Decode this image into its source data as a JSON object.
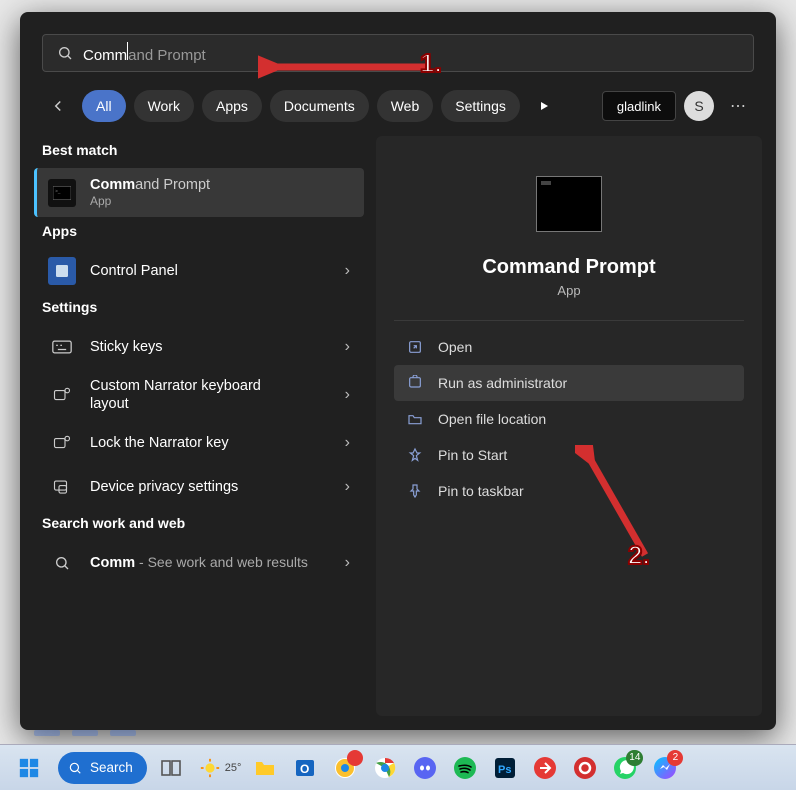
{
  "search": {
    "typed": "Comm",
    "completion": "and Prompt"
  },
  "tabs": {
    "all": "All",
    "work": "Work",
    "apps": "Apps",
    "documents": "Documents",
    "web": "Web",
    "settings": "Settings"
  },
  "store_pill": "gladlink",
  "avatar_initial": "S",
  "left": {
    "best_match_label": "Best match",
    "best_item": {
      "match": "Comm",
      "rest": "and Prompt",
      "sub": "App"
    },
    "apps_label": "Apps",
    "apps": [
      {
        "title": "Control Panel"
      }
    ],
    "settings_label": "Settings",
    "settings": [
      {
        "title": "Sticky keys"
      },
      {
        "title": "Custom Narrator keyboard layout"
      },
      {
        "title": "Lock the Narrator key"
      },
      {
        "title": "Device privacy settings"
      }
    ],
    "search_web_label": "Search work and web",
    "web": [
      {
        "match": "Comm",
        "sub": " - See work and web results"
      }
    ]
  },
  "preview": {
    "title": "Command Prompt",
    "sub": "App",
    "actions": {
      "open": "Open",
      "run_admin": "Run as administrator",
      "open_loc": "Open file location",
      "pin_start": "Pin to Start",
      "pin_taskbar": "Pin to taskbar"
    }
  },
  "annotations": {
    "one": "1.",
    "two": "2."
  },
  "taskbar": {
    "search": "Search",
    "weather_temp": "25°",
    "whatsapp_badge": "14",
    "messenger_badge": "2"
  }
}
